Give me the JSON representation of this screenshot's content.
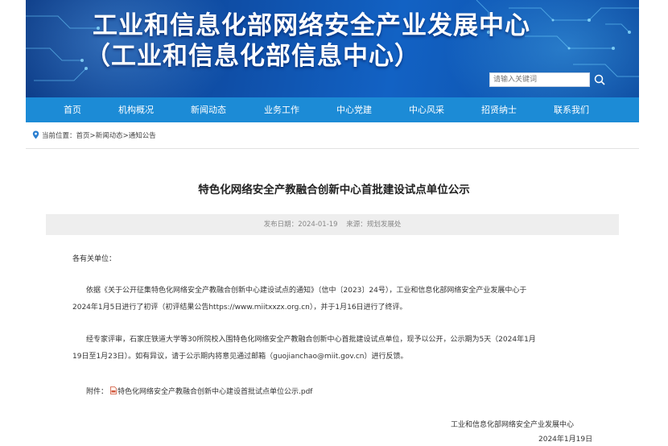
{
  "header": {
    "title": "工业和信息化部网络安全产业发展中心",
    "subtitle": "（工业和信息化部信息中心）",
    "search": {
      "placeholder": "请输入关键词",
      "icon": "search-icon"
    }
  },
  "nav": {
    "items": [
      {
        "label": "首页"
      },
      {
        "label": "机构概况"
      },
      {
        "label": "新闻动态"
      },
      {
        "label": "业务工作"
      },
      {
        "label": "中心党建"
      },
      {
        "label": "中心风采"
      },
      {
        "label": "招贤纳士"
      },
      {
        "label": "联系我们"
      }
    ]
  },
  "breadcrumb": {
    "prefix": "当前位置：",
    "items": [
      "首页",
      "新闻动态",
      "通知公告"
    ],
    "separator": ">",
    "icon": "location-pin-icon"
  },
  "article": {
    "title": "特色化网络安全产教融合创新中心首批建设试点单位公示",
    "date_label": "发布日期：",
    "date": "2024-01-19",
    "source_label": "来源：",
    "source": "规划发展处",
    "salutation": "各有关单位：",
    "para1_line1": "依据《关于公开征集特色化网络安全产教融合创新中心建设试点的通知》（信中〔2023〕24号），工业和信息化部网络安全产业发展中心于",
    "para1_line2": "2024年1月5日进行了初评（初评结果公告https://www.miitxxzx.org.cn），并于1月16日进行了终评。",
    "para2_line1": "经专家评审，石家庄铁道大学等30所院校入围特色化网络安全产教融合创新中心首批建设试点单位，现予以公开，公示期为5天（2024年1月",
    "para2_line2": "19日至1月23日）。如有异议，请于公示期内将意见通过邮箱（guojianchao@miit.gov.cn）进行反馈。",
    "attachment_label": "附件：",
    "attachment_name": "特色化网络安全产教融合创新中心建设首批试点单位公示.pdf",
    "attachment_icon": "pdf-icon",
    "signature_org": "工业和信息化部网络安全产业发展中心",
    "signature_date": "2024年1月19日"
  },
  "colors": {
    "nav_bg": "#1c8bd6",
    "banner_bg": "#0f4fa8",
    "meta_bg": "#eeeeee"
  }
}
